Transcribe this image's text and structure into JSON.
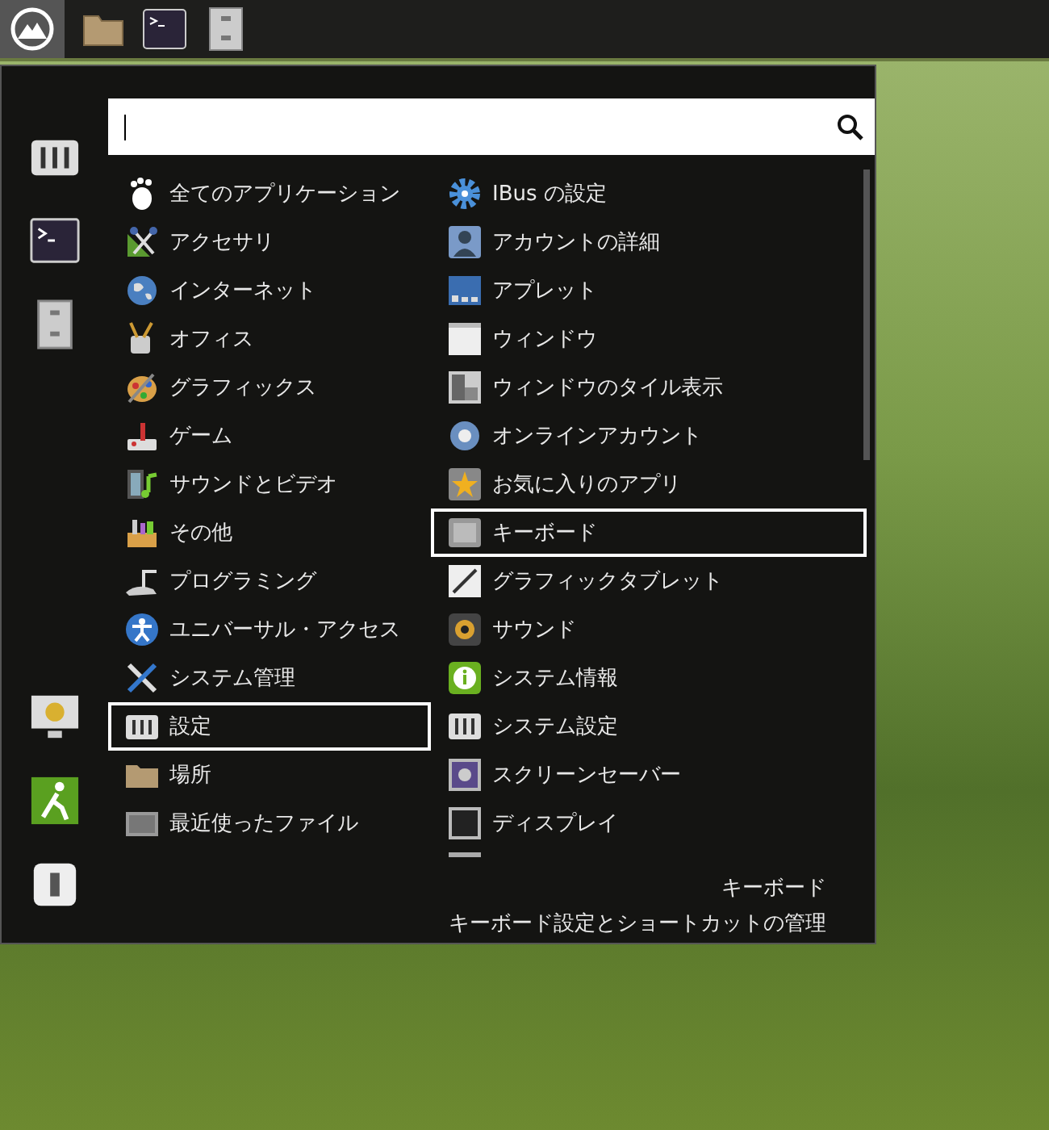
{
  "categories": [
    {
      "label": "全てのアプリケーション",
      "selected": false
    },
    {
      "label": "アクセサリ",
      "selected": false
    },
    {
      "label": "インターネット",
      "selected": false
    },
    {
      "label": "オフィス",
      "selected": false
    },
    {
      "label": "グラフィックス",
      "selected": false
    },
    {
      "label": "ゲーム",
      "selected": false
    },
    {
      "label": "サウンドとビデオ",
      "selected": false
    },
    {
      "label": "その他",
      "selected": false
    },
    {
      "label": "プログラミング",
      "selected": false
    },
    {
      "label": "ユニバーサル・アクセス",
      "selected": false
    },
    {
      "label": "システム管理",
      "selected": false
    },
    {
      "label": "設定",
      "selected": true
    },
    {
      "label": "場所",
      "selected": false
    },
    {
      "label": "最近使ったファイル",
      "selected": false
    }
  ],
  "apps": [
    {
      "label": "IBus の設定",
      "selected": false
    },
    {
      "label": "アカウントの詳細",
      "selected": false
    },
    {
      "label": "アプレット",
      "selected": false
    },
    {
      "label": "ウィンドウ",
      "selected": false
    },
    {
      "label": "ウィンドウのタイル表示",
      "selected": false
    },
    {
      "label": "オンラインアカウント",
      "selected": false
    },
    {
      "label": "お気に入りのアプリ",
      "selected": false
    },
    {
      "label": "キーボード",
      "selected": true
    },
    {
      "label": "グラフィックタブレット",
      "selected": false
    },
    {
      "label": "サウンド",
      "selected": false
    },
    {
      "label": "システム情報",
      "selected": false
    },
    {
      "label": "システム設定",
      "selected": false
    },
    {
      "label": "スクリーンセーバー",
      "selected": false
    },
    {
      "label": "ディスプレイ",
      "selected": false
    }
  ],
  "description": {
    "title": "キーボード",
    "text": "キーボード設定とショートカットの管理"
  }
}
